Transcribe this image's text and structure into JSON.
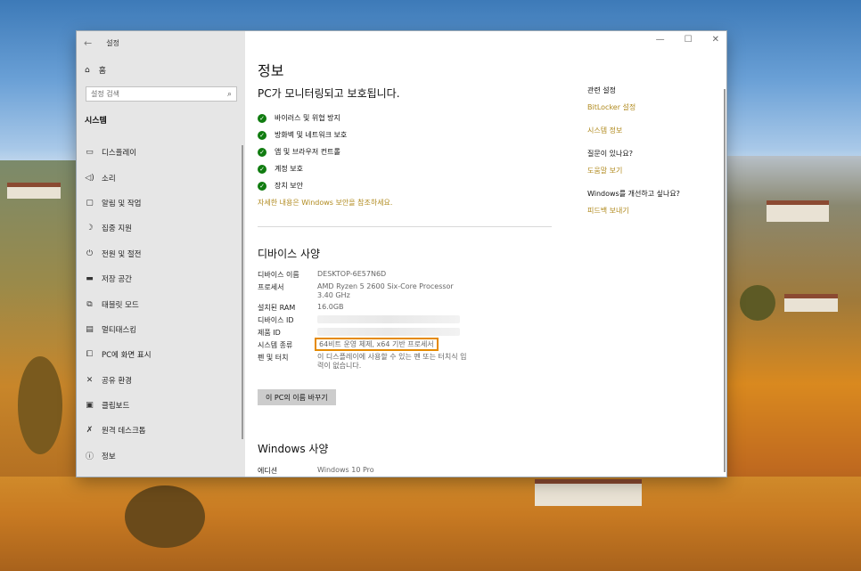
{
  "window": {
    "app_title": "설정",
    "controls": {
      "minimize": "—",
      "maximize": "☐",
      "close": "✕"
    }
  },
  "sidebar": {
    "home_label": "홈",
    "search_placeholder": "설정 검색",
    "section_title": "시스템",
    "items": [
      {
        "label": "디스플레이",
        "icon": "display-icon"
      },
      {
        "label": "소리",
        "icon": "sound-icon"
      },
      {
        "label": "알림 및 작업",
        "icon": "notification-icon"
      },
      {
        "label": "집중 지원",
        "icon": "focus-moon-icon"
      },
      {
        "label": "전원 및 절전",
        "icon": "power-icon"
      },
      {
        "label": "저장 공간",
        "icon": "storage-icon"
      },
      {
        "label": "태블릿 모드",
        "icon": "tablet-icon"
      },
      {
        "label": "멀티태스킹",
        "icon": "multitask-icon"
      },
      {
        "label": "PC에 화면 표시",
        "icon": "project-icon"
      },
      {
        "label": "공유 환경",
        "icon": "share-icon"
      },
      {
        "label": "클립보드",
        "icon": "clipboard-icon"
      },
      {
        "label": "원격 데스크톱",
        "icon": "remote-desktop-icon"
      },
      {
        "label": "정보",
        "icon": "info-icon"
      }
    ],
    "active_index": 12
  },
  "main": {
    "page_title": "정보",
    "protection_heading": "PC가 모니터링되고 보호됩니다.",
    "protection_items": [
      "바이러스 및 위협 방지",
      "방화벽 및 네트워크 보호",
      "앱 및 브라우저 컨트롤",
      "계정 보호",
      "장치 보안"
    ],
    "security_link": "자세한 내용은 Windows 보안을 참조하세요.",
    "device_heading": "디바이스 사양",
    "specs": {
      "device_name_key": "디바이스 이름",
      "device_name_val": "DESKTOP-6E57N6D",
      "processor_key": "프로세서",
      "processor_val_1": "AMD Ryzen 5 2600 Six-Core Processor",
      "processor_val_2": "3.40 GHz",
      "ram_key": "설치된 RAM",
      "ram_val": "16.0GB",
      "device_id_key": "디바이스 ID",
      "product_id_key": "제품 ID",
      "system_type_key": "시스템 종류",
      "system_type_val": "64비트 운영 체제, x64 기반 프로세서",
      "pen_touch_key": "펜 및 터치",
      "pen_touch_val": "이 디스플레이에 사용할 수 있는 펜 또는 터치식 입력이 없습니다."
    },
    "rename_button": "이 PC의 이름 바꾸기",
    "windows_heading": "Windows 사양",
    "edition_key": "에디션",
    "edition_val": "Windows 10 Pro"
  },
  "related": {
    "title": "관련 설정",
    "bitlocker": "BitLocker 설정",
    "system_info": "시스템 정보",
    "question_title": "질문이 있나요?",
    "get_help": "도움말 보기",
    "improve_title": "Windows를 개선하고 싶나요?",
    "feedback": "피드백 보내기"
  },
  "colors": {
    "accent": "#b08a1e",
    "check_green": "#107c10",
    "highlight_border": "#e58a00",
    "sidebar_bg": "#e6e6e6"
  }
}
